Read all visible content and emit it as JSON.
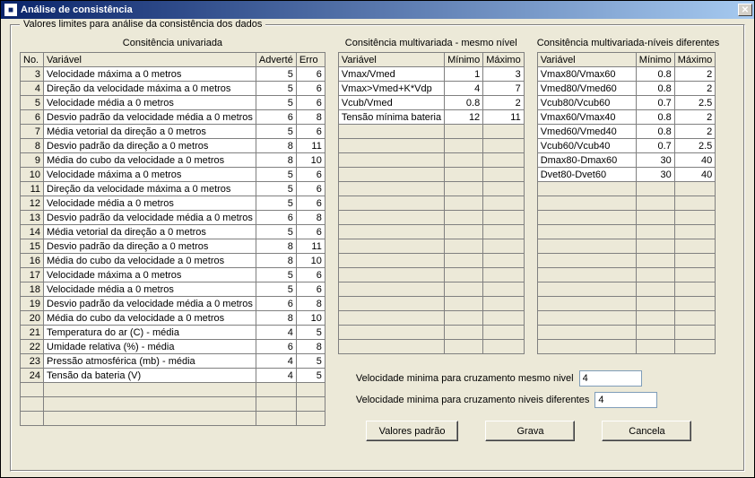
{
  "window": {
    "title": "Análise de consistência"
  },
  "group_legend": "Valores limites para análise da consistência dos dados",
  "sections": {
    "uni_label": "Consitência univariada",
    "multi_same_label": "Consitência multivariada - mesmo nível",
    "multi_diff_label": "Consitência multivariada-níveis diferentes"
  },
  "uni": {
    "headers": {
      "no": "No.",
      "var": "Variável",
      "adv": "Adverté",
      "err": "Erro"
    },
    "rows": [
      {
        "no": 3,
        "var": "Velocidade máxima a 0 metros",
        "adv": 5,
        "err": 6
      },
      {
        "no": 4,
        "var": "Direção da velocidade máxima a 0 metros",
        "adv": 5,
        "err": 6
      },
      {
        "no": 5,
        "var": "Velocidade média a 0 metros",
        "adv": 5,
        "err": 6
      },
      {
        "no": 6,
        "var": "Desvio padrão da velocidade média a 0 metros",
        "adv": 6,
        "err": 8
      },
      {
        "no": 7,
        "var": "Média vetorial da direção a 0 metros",
        "adv": 5,
        "err": 6
      },
      {
        "no": 8,
        "var": "Desvio padrão da direção a 0 metros",
        "adv": 8,
        "err": 11
      },
      {
        "no": 9,
        "var": "Média do cubo da velocidade a 0 metros",
        "adv": 8,
        "err": 10
      },
      {
        "no": 10,
        "var": "Velocidade máxima a 0 metros",
        "adv": 5,
        "err": 6
      },
      {
        "no": 11,
        "var": "Direção da velocidade máxima a 0 metros",
        "adv": 5,
        "err": 6
      },
      {
        "no": 12,
        "var": "Velocidade média a 0 metros",
        "adv": 5,
        "err": 6
      },
      {
        "no": 13,
        "var": "Desvio padrão da velocidade média a 0 metros",
        "adv": 6,
        "err": 8
      },
      {
        "no": 14,
        "var": "Média vetorial da direção a 0 metros",
        "adv": 5,
        "err": 6
      },
      {
        "no": 15,
        "var": "Desvio padrão da direção a 0 metros",
        "adv": 8,
        "err": 11
      },
      {
        "no": 16,
        "var": "Média do cubo da velocidade a 0 metros",
        "adv": 8,
        "err": 10
      },
      {
        "no": 17,
        "var": "Velocidade máxima a 0 metros",
        "adv": 5,
        "err": 6
      },
      {
        "no": 18,
        "var": "Velocidade média a 0 metros",
        "adv": 5,
        "err": 6
      },
      {
        "no": 19,
        "var": "Desvio padrão da velocidade média a 0 metros",
        "adv": 6,
        "err": 8
      },
      {
        "no": 20,
        "var": "Média do cubo da velocidade a 0 metros",
        "adv": 8,
        "err": 10
      },
      {
        "no": 21,
        "var": "Temperatura do ar (C) - média",
        "adv": 4,
        "err": 5
      },
      {
        "no": 22,
        "var": "Umidade relativa (%)  - média",
        "adv": 6,
        "err": 8
      },
      {
        "no": 23,
        "var": "Pressão atmosférica (mb) - média",
        "adv": 4,
        "err": 5
      },
      {
        "no": 24,
        "var": "Tensão da bateria  (V)",
        "adv": 4,
        "err": 5
      }
    ],
    "blank_rows": 3
  },
  "multi_same": {
    "headers": {
      "var": "Variável",
      "min": "Mínimo",
      "max": "Máximo"
    },
    "rows": [
      {
        "var": "Vmax/Vmed",
        "min": "1",
        "max": "3"
      },
      {
        "var": "Vmax>Vmed+K*Vdp",
        "min": "4",
        "max": "7"
      },
      {
        "var": "Vcub/Vmed",
        "min": "0.8",
        "max": "2"
      },
      {
        "var": "Tensão mínima bateria",
        "min": "12",
        "max": "11"
      }
    ],
    "blank_rows": 16
  },
  "multi_diff": {
    "headers": {
      "var": "Variável",
      "min": "Mínimo",
      "max": "Máximo"
    },
    "rows": [
      {
        "var": "Vmax80/Vmax60",
        "min": "0.8",
        "max": "2"
      },
      {
        "var": "Vmed80/Vmed60",
        "min": "0.8",
        "max": "2"
      },
      {
        "var": "Vcub80/Vcub60",
        "min": "0.7",
        "max": "2.5"
      },
      {
        "var": "Vmax60/Vmax40",
        "min": "0.8",
        "max": "2"
      },
      {
        "var": "Vmed60/Vmed40",
        "min": "0.8",
        "max": "2"
      },
      {
        "var": "Vcub60/Vcub40",
        "min": "0.7",
        "max": "2.5"
      },
      {
        "var": "Dmax80-Dmax60",
        "min": "30",
        "max": "40"
      },
      {
        "var": "Dvet80-Dvet60",
        "min": "30",
        "max": "40"
      }
    ],
    "blank_rows": 12
  },
  "inputs": {
    "vel_same_label": "Velocidade minima para cruzamento mesmo nivel",
    "vel_same_value": "4",
    "vel_diff_label": "Velocidade minima para cruzamento niveis diferentes",
    "vel_diff_value": "4"
  },
  "buttons": {
    "defaults": "Valores padrão",
    "save": "Grava",
    "cancel": "Cancela"
  }
}
